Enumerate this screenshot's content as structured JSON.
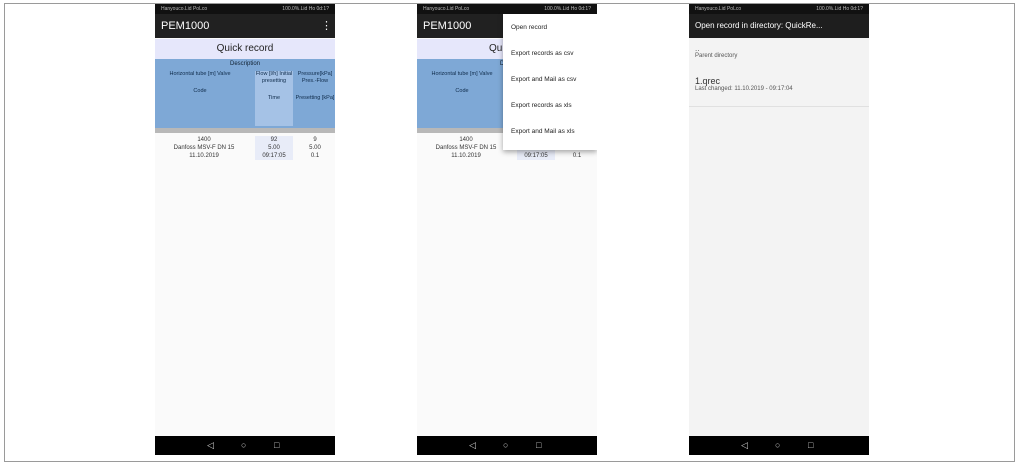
{
  "screens": [
    {
      "statusbar": {
        "left": "Hanyouco.Lid PoLco",
        "right": "100.0%.Lid Ho 0d:1?"
      },
      "appbar": {
        "title": "PEM1000",
        "menu_icon": "⋮"
      },
      "header": "Quick record",
      "table": {
        "description": "Description",
        "columns": [
          {
            "head": "Horizontal tube [m] Valve",
            "sub": "Code"
          },
          {
            "head": "Flow [l/h] Initial presetting",
            "sub": "Time"
          },
          {
            "head": "Pressure[kPa] Pres.-Flow",
            "sub": "Presetting [kPa]"
          }
        ],
        "row": {
          "c1": [
            "1400",
            "Danfoss MSV-F DN 15",
            "11.10.2019"
          ],
          "c2": [
            "92",
            "5.00",
            "09:17:05"
          ],
          "c3": [
            "9",
            "5.00",
            "0.1"
          ]
        }
      },
      "navbar": {
        "back": "◁",
        "home": "○",
        "recent": "□"
      }
    },
    {
      "statusbar": {
        "left": "Hanyouco.Lid PoLco",
        "right": "100.0%.Lid Ho 0d:1?"
      },
      "appbar": {
        "title": "PEM1000"
      },
      "header_partial": "Qui",
      "table": {
        "description_partial": "D",
        "columns": [
          {
            "head": "Horizontal tube [m] Valve",
            "sub": "Code"
          },
          {
            "head": "Flow [l/h]",
            "sub": ""
          },
          {
            "head": "Pressure[kPa]",
            "sub": ""
          }
        ],
        "row": {
          "c1": [
            "1400",
            "Danfoss MSV-F DN 15",
            "11.10.2019"
          ],
          "c2": [
            "92",
            "5.00",
            "09:17:05"
          ],
          "c3": [
            "9",
            "5.00",
            "0.1"
          ]
        }
      },
      "menu": [
        "Open record",
        "Export records as csv",
        "Export and Mail as csv",
        "Export records as xls",
        "Export and Mail as xls"
      ],
      "navbar": {
        "back": "◁",
        "home": "○",
        "recent": "□"
      }
    },
    {
      "statusbar": {
        "left": "Hanyouco.Lid PoLco",
        "right": "100.0%.Lid Ho 0d:1?"
      },
      "dialog_title": "Open record in directory: QuickRe...",
      "items": [
        {
          "name": "..",
          "sub": "Parent directory"
        },
        {
          "name": "1.qrec",
          "sub": "Last changed: 11.10.2019 - 09:17:04"
        }
      ],
      "navbar": {
        "back": "◁",
        "home": "○",
        "recent": "□"
      }
    }
  ],
  "colors": {
    "appbar": "#212121",
    "header_bg": "#e6e7fb",
    "table_bg": "#7ea8d6",
    "navbar": "#000000"
  }
}
